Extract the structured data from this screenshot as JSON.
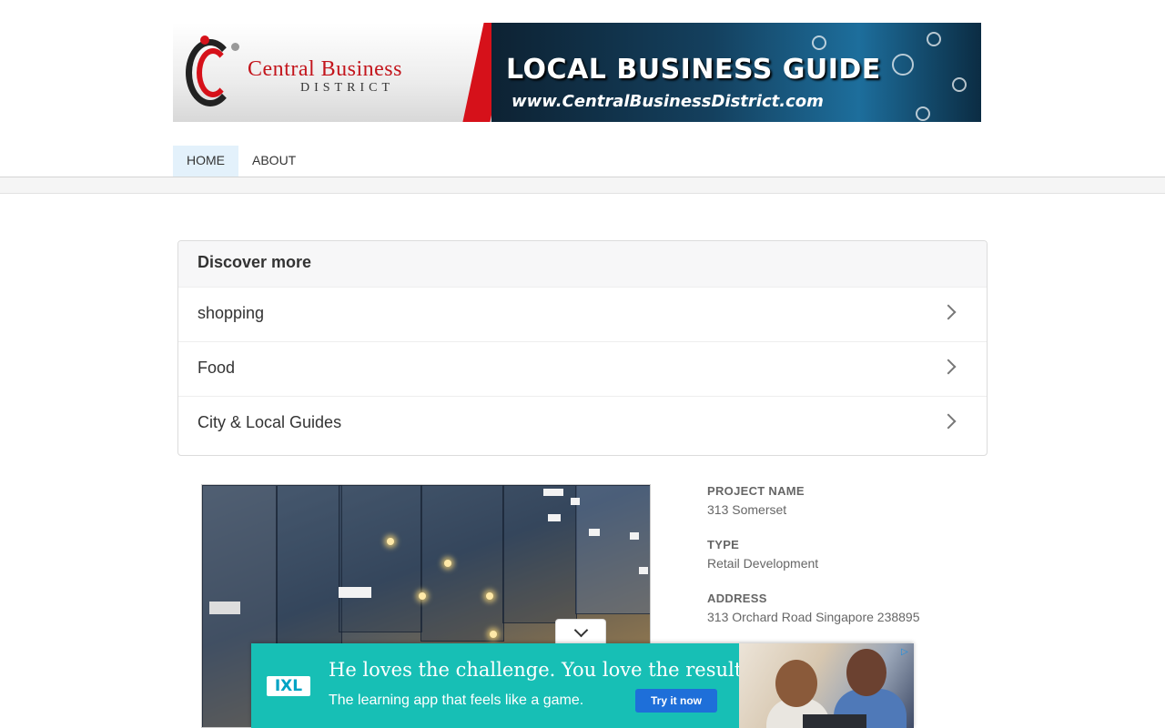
{
  "banner": {
    "logo_title_main": "Central Business",
    "logo_subtitle": "DISTRICT",
    "headline": "LOCAL BUSINESS GUIDE",
    "url": "www.CentralBusinessDistrict.com"
  },
  "nav": {
    "items": [
      {
        "label": "HOME",
        "active": true
      },
      {
        "label": "ABOUT",
        "active": false
      }
    ]
  },
  "discover": {
    "heading": "Discover more",
    "items": [
      {
        "label": "shopping"
      },
      {
        "label": "Food"
      },
      {
        "label": "City & Local Guides"
      }
    ]
  },
  "details": [
    {
      "label": "PROJECT NAME",
      "value": "313 Somerset"
    },
    {
      "label": "TYPE",
      "value": "Retail Development"
    },
    {
      "label": "ADDRESS",
      "value": "313 Orchard Road Singapore 238895"
    }
  ],
  "ad": {
    "logo": "IXL",
    "headline": "He loves the challenge. You love the results.",
    "subtext": "The learning app that feels like a game.",
    "cta": "Try it now",
    "colors": {
      "background": "#17bfb5",
      "cta": "#1e6fd9"
    }
  },
  "colors": {
    "nav_active_bg": "#e3f1fb",
    "brand_red": "#d6111a"
  }
}
